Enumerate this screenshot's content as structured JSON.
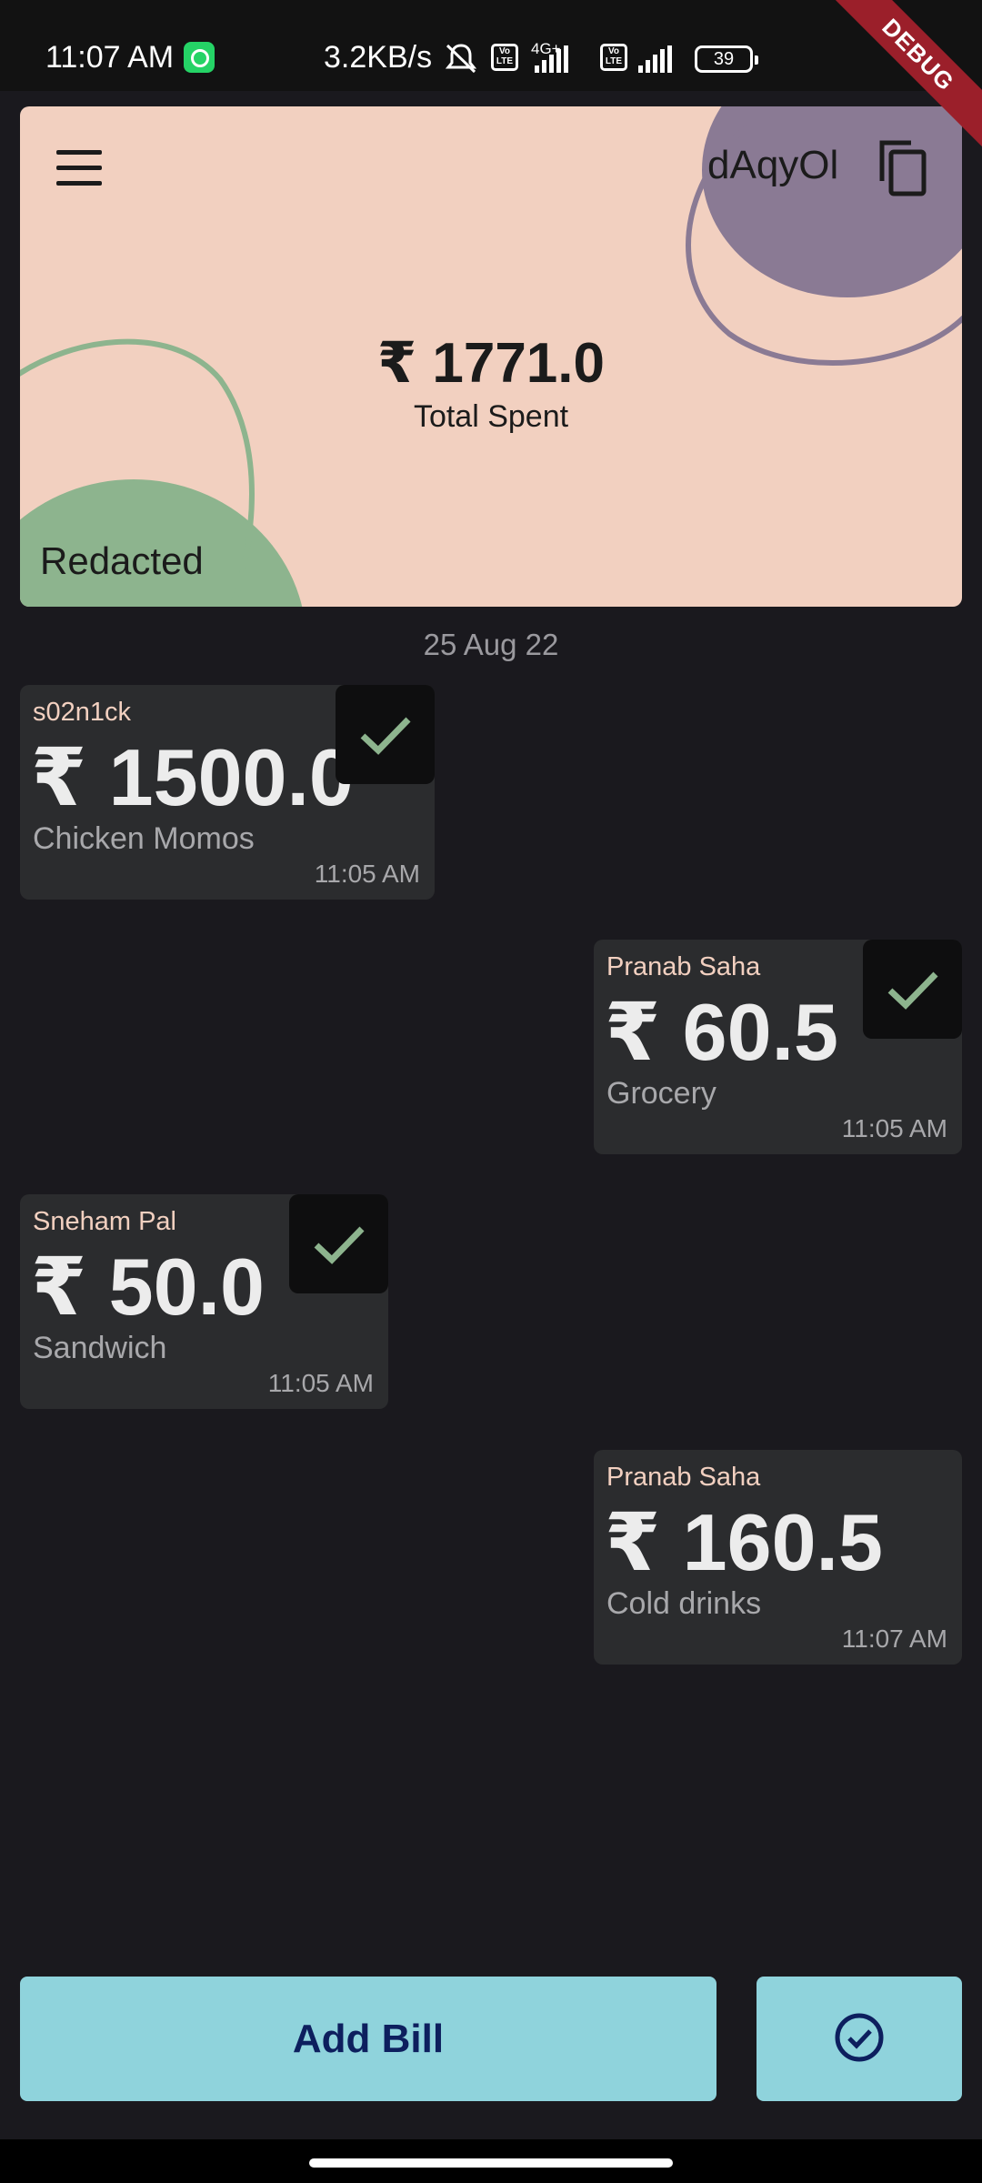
{
  "status_bar": {
    "time": "11:07 AM",
    "network_speed": "3.2KB/s",
    "volte_1": "Vo LTE",
    "network_type": "4G+",
    "volte_2": "Vo LTE",
    "battery": "39",
    "debug_banner": "DEBUG"
  },
  "header": {
    "room_code": "dAqyOl",
    "total_amount": "₹ 1771.0",
    "total_label": "Total Spent",
    "user_name": "Redacted",
    "colors": {
      "card_bg": "#f2d0c0",
      "green_blob": "#8db48e",
      "purple_blob": "#8a7a94"
    }
  },
  "date_label": "25 Aug 22",
  "bills": [
    {
      "name": "s02n1ck",
      "amount": "₹ 1500.0",
      "description": "Chicken Momos",
      "time": "11:05 AM",
      "settled": true
    },
    {
      "name": "Pranab Saha",
      "amount": "₹ 60.5",
      "description": "Grocery",
      "time": "11:05 AM",
      "settled": true
    },
    {
      "name": "Sneham Pal",
      "amount": "₹ 50.0",
      "description": "Sandwich",
      "time": "11:05 AM",
      "settled": true
    },
    {
      "name": "Pranab Saha",
      "amount": "₹ 160.5",
      "description": "Cold drinks",
      "time": "11:07 AM",
      "settled": false
    }
  ],
  "actions": {
    "add_bill_label": "Add Bill",
    "done_icon": "check-circle-icon",
    "accent_color": "#8fd3dc"
  }
}
